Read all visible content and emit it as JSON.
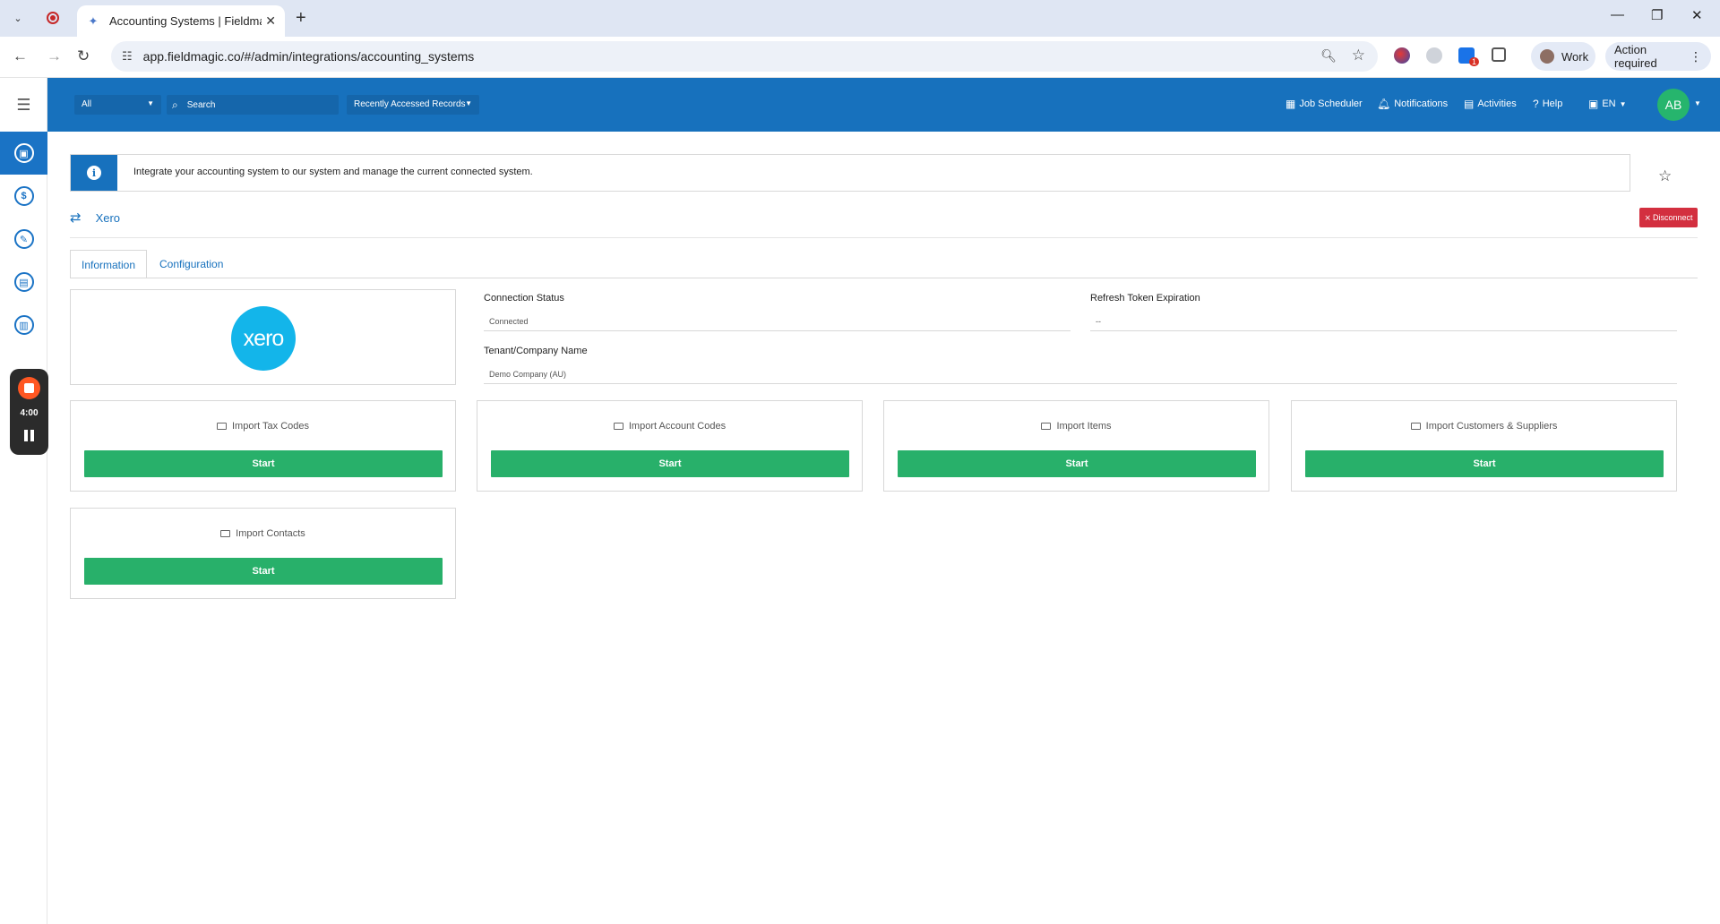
{
  "browser": {
    "tab_title": "Accounting Systems | Fieldmag",
    "url": "app.fieldmagic.co/#/admin/integrations/accounting_systems",
    "profile_label": "Work",
    "action_label": "Action required",
    "extension_badge": "1"
  },
  "recorder": {
    "time": "4:00"
  },
  "header": {
    "scope_select": "All",
    "search_placeholder": "Search",
    "recent_records": "Recently Accessed Records",
    "links": {
      "job_scheduler": "Job Scheduler",
      "notifications": "Notifications",
      "activities": "Activities",
      "help": "Help",
      "language": "EN"
    },
    "user_initials": "AB"
  },
  "page": {
    "info_text": "Integrate your accounting system to our system and manage the current connected system.",
    "system_name": "Xero",
    "disconnect_label": "Disconnect",
    "tabs": [
      "Information",
      "Configuration"
    ],
    "logo_text": "xero",
    "fields": {
      "connection_status_label": "Connection Status",
      "connection_status_value": "Connected",
      "refresh_token_label": "Refresh Token Expiration",
      "refresh_token_value": "--",
      "tenant_label": "Tenant/Company Name",
      "tenant_value": "Demo Company (AU)"
    },
    "imports": [
      {
        "title": "Import Tax Codes",
        "button": "Start"
      },
      {
        "title": "Import Account Codes",
        "button": "Start"
      },
      {
        "title": "Import Items",
        "button": "Start"
      },
      {
        "title": "Import Customers & Suppliers",
        "button": "Start"
      },
      {
        "title": "Import Contacts",
        "button": "Start"
      }
    ]
  },
  "colors": {
    "brand_blue": "#1771bd",
    "start_green": "#28b06a",
    "disconnect_red": "#d32f3f",
    "xero_blue": "#13b5ea"
  }
}
